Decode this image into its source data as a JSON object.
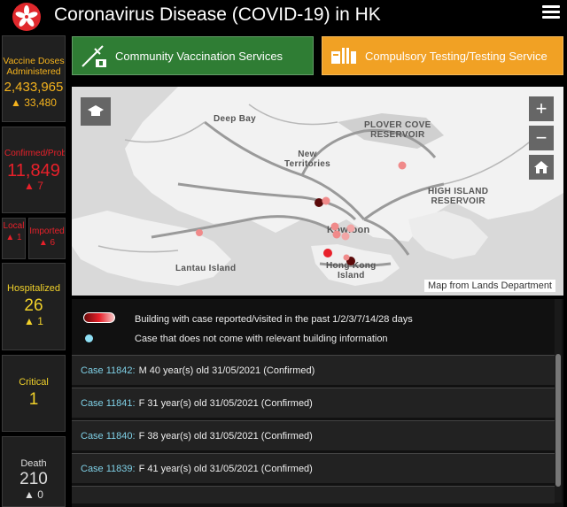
{
  "header": {
    "title": "Coronavirus Disease (COVID-19) in HK"
  },
  "stats": {
    "vaccine": {
      "label": "Vaccine Doses Administered",
      "value": "2,433,965",
      "delta": "▲ 33,480"
    },
    "confirmed": {
      "label": "Confirmed/Probable",
      "value": "11,849",
      "delta": "▲ 7"
    },
    "local": {
      "label": "Local",
      "delta": "▲ 1"
    },
    "imported": {
      "label": "Imported",
      "delta": "▲ 6"
    },
    "hospitalized": {
      "label": "Hospitalized",
      "value": "26",
      "delta": "▲ 1"
    },
    "critical": {
      "label": "Critical",
      "value": "1"
    },
    "death": {
      "label": "Death",
      "value": "210",
      "delta": "▲ 0"
    }
  },
  "buttons": {
    "vaccination": "Community Vaccination Services",
    "testing": "Compulsory Testing/Testing Service"
  },
  "map": {
    "labels": {
      "deep_bay": "Deep Bay",
      "plover_cove": "PLOVER COVE\nRESERVOIR",
      "new_territories": "New\nTerritories",
      "high_island": "HIGH ISLAND\nRESERVOIR",
      "kowloon": "Kowloon",
      "lantau": "Lantau Island",
      "hong_kong_island": "Hong Kong\nIsland"
    },
    "attribution": "Map from Lands Department",
    "zoom_in": "+",
    "zoom_out": "−"
  },
  "legend": {
    "building": "Building with case reported/visited in the past 1/2/3/7/14/28 days",
    "no_building": "Case that does not come with relevant building information"
  },
  "cases": [
    {
      "id": "Case 11842:",
      "details": "M  40 year(s) old  31/05/2021 (Confirmed)"
    },
    {
      "id": "Case 11841:",
      "details": "F  31 year(s) old  31/05/2021 (Confirmed)"
    },
    {
      "id": "Case 11840:",
      "details": "F  38 year(s) old  31/05/2021 (Confirmed)"
    },
    {
      "id": "Case 11839:",
      "details": "F  41 year(s) old  31/05/2021 (Confirmed)"
    }
  ],
  "colors": {
    "vaccine": "#f5b31d",
    "confirmed": "#e8202a",
    "hospitalized": "#f1d12a",
    "vaccination_button": "#2f7d34",
    "testing_button": "#f1a124",
    "case_id": "#7fd0e6"
  }
}
